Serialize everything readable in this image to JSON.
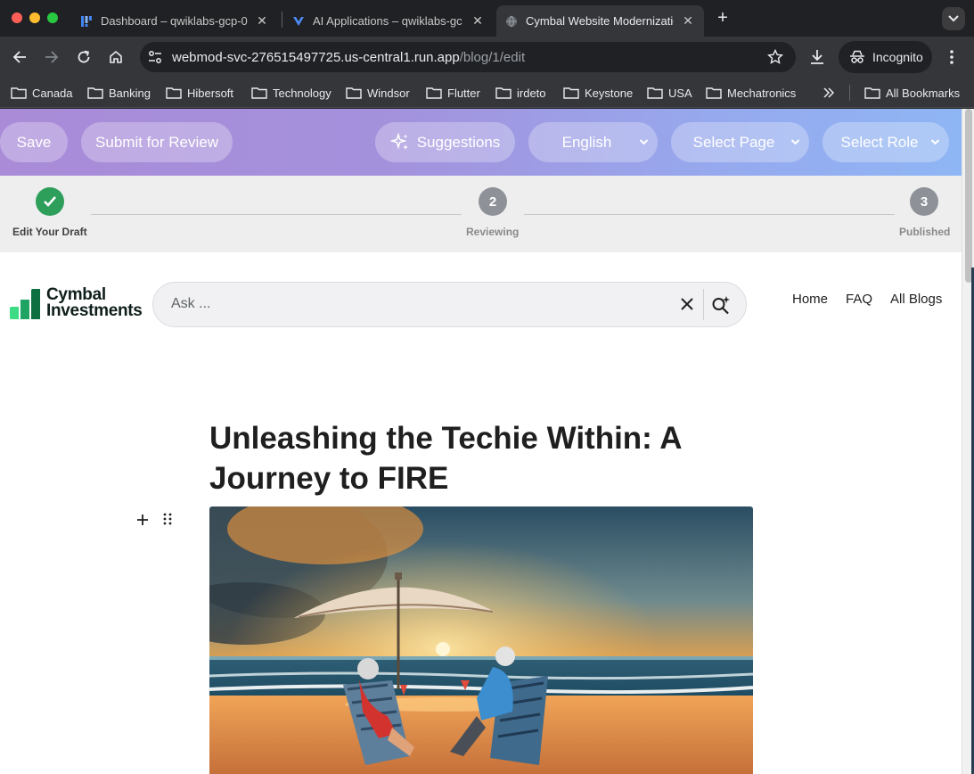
{
  "browser": {
    "tabs": [
      {
        "title": "Dashboard – qwiklabs-gcp-0",
        "active": false
      },
      {
        "title": "AI Applications – qwiklabs-gc",
        "active": false
      },
      {
        "title": "Cymbal Website Modernizatio",
        "active": true
      }
    ],
    "url_host": "webmod-svc-276515497725.us-central1.run.app",
    "url_path": "/blog/1/edit",
    "profile_label": "Incognito",
    "bookmarks": [
      "Canada",
      "Banking",
      "Hibersoft",
      "Technology",
      "Windsor",
      "Flutter",
      "irdeto",
      "Keystone",
      "USA",
      "Mechatronics"
    ],
    "all_bookmarks_label": "All Bookmarks"
  },
  "editor": {
    "save_label": "Save",
    "submit_label": "Submit for Review",
    "suggestions_label": "Suggestions",
    "language_value": "English",
    "page_select_value": "Select Page",
    "role_select_value": "Select Role"
  },
  "stepper": {
    "steps": [
      {
        "number": "1",
        "label": "Edit Your Draft",
        "status": "done"
      },
      {
        "number": "2",
        "label": "Reviewing",
        "status": "pending"
      },
      {
        "number": "3",
        "label": "Published",
        "status": "pending"
      }
    ]
  },
  "site": {
    "logo_line1": "Cymbal",
    "logo_line2": "Investments",
    "search_placeholder": "Ask ...",
    "nav": [
      "Home",
      "FAQ",
      "All Blogs"
    ]
  },
  "article": {
    "title": "Unleashing the Techie Within: A Journey to FIRE",
    "hero_image_icon": "beach-sunset-image"
  },
  "colors": {
    "editbar_start": "#a98bd8",
    "editbar_end": "#8fb6f4",
    "step_done": "#2e9e5b",
    "step_pending": "#8e9298",
    "logo_green": "#1e9e52"
  }
}
